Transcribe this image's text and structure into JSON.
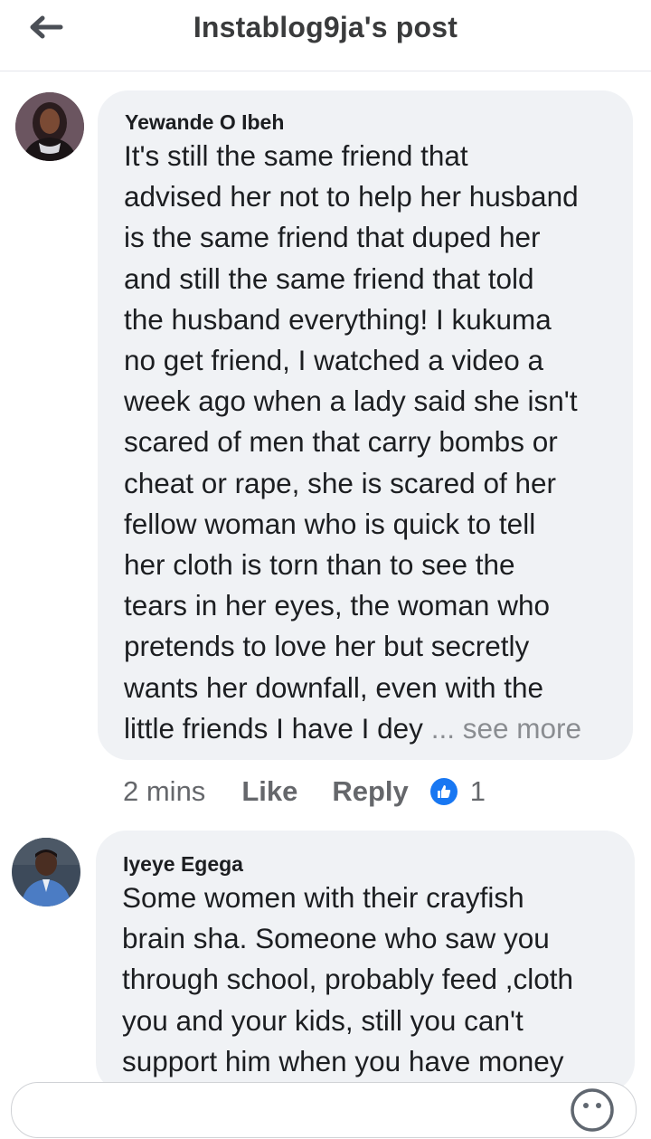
{
  "header": {
    "title": "Instablog9ja's post",
    "back_icon": "back-arrow-icon"
  },
  "comments": [
    {
      "author": "Yewande O Ibeh",
      "lines": [
        "It's still the same friend that",
        "advised her not to help her husband",
        "is the same friend that duped her",
        "and still the same friend that told",
        "the husband everything! I kukuma",
        "no get friend, I watched a video a",
        "week ago when a lady said she isn't",
        "scared of men that carry bombs or",
        "cheat or rape, she is scared of her",
        "fellow woman who is quick to tell",
        "her cloth is torn than to see the",
        "tears in her eyes, the woman who",
        "pretends to love her  but secretly",
        "wants her downfall, even with the",
        "little friends I have I dey"
      ],
      "see_more": "... see more",
      "time": "2 mins",
      "like_label": "Like",
      "reply_label": "Reply",
      "reaction_count": "1"
    },
    {
      "author": "Iyeye Egega",
      "lines": [
        "Some women with their crayfish",
        "brain sha. Someone who saw you",
        "through school, probably feed ,cloth",
        "you and your kids, still you can't",
        "support him when you have money"
      ]
    }
  ],
  "colors": {
    "bubble": "#f0f2f5",
    "meta_text": "#65676b",
    "accent": "#1877f2"
  }
}
